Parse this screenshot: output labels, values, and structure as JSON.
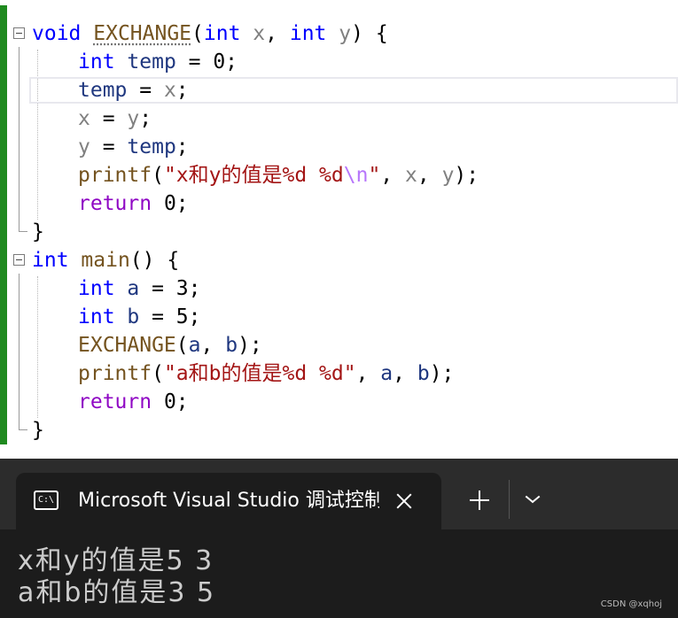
{
  "editor": {
    "lines": [
      {
        "tokens": [
          {
            "t": "void",
            "c": "kw"
          },
          {
            "t": " "
          },
          {
            "t": "EXCHANGE",
            "c": "fn dots"
          },
          {
            "t": "("
          },
          {
            "t": "int",
            "c": "kw"
          },
          {
            "t": " "
          },
          {
            "t": "x",
            "c": "prm"
          },
          {
            "t": ", "
          },
          {
            "t": "int",
            "c": "kw"
          },
          {
            "t": " "
          },
          {
            "t": "y",
            "c": "prm"
          },
          {
            "t": ") {"
          }
        ]
      },
      {
        "tokens": [
          {
            "t": "int",
            "c": "kw"
          },
          {
            "t": " "
          },
          {
            "t": "temp",
            "c": "var"
          },
          {
            "t": " = 0;"
          }
        ]
      },
      {
        "tokens": [
          {
            "t": "temp",
            "c": "var"
          },
          {
            "t": " = "
          },
          {
            "t": "x",
            "c": "prm"
          },
          {
            "t": ";"
          }
        ]
      },
      {
        "tokens": [
          {
            "t": "x",
            "c": "prm"
          },
          {
            "t": " = "
          },
          {
            "t": "y",
            "c": "prm"
          },
          {
            "t": ";"
          }
        ]
      },
      {
        "tokens": [
          {
            "t": "y",
            "c": "prm"
          },
          {
            "t": " = "
          },
          {
            "t": "temp",
            "c": "var"
          },
          {
            "t": ";"
          }
        ]
      },
      {
        "tokens": [
          {
            "t": "printf",
            "c": "fn"
          },
          {
            "t": "("
          },
          {
            "t": "\"x和y的值是%d %d",
            "c": "str"
          },
          {
            "t": "\\n",
            "c": "esc"
          },
          {
            "t": "\"",
            "c": "str"
          },
          {
            "t": ", "
          },
          {
            "t": "x",
            "c": "prm"
          },
          {
            "t": ", "
          },
          {
            "t": "y",
            "c": "prm"
          },
          {
            "t": ");"
          }
        ]
      },
      {
        "tokens": [
          {
            "t": "return",
            "c": "ctl"
          },
          {
            "t": " 0;"
          }
        ]
      },
      {
        "tokens": [
          {
            "t": "}"
          }
        ]
      },
      {
        "tokens": [
          {
            "t": "int",
            "c": "kw"
          },
          {
            "t": " "
          },
          {
            "t": "main",
            "c": "fn"
          },
          {
            "t": "() {"
          }
        ]
      },
      {
        "tokens": [
          {
            "t": "int",
            "c": "kw"
          },
          {
            "t": " "
          },
          {
            "t": "a",
            "c": "var"
          },
          {
            "t": " = 3;"
          }
        ]
      },
      {
        "tokens": [
          {
            "t": "int",
            "c": "kw"
          },
          {
            "t": " "
          },
          {
            "t": "b",
            "c": "var"
          },
          {
            "t": " = 5;"
          }
        ]
      },
      {
        "tokens": [
          {
            "t": "EXCHANGE",
            "c": "fn"
          },
          {
            "t": "("
          },
          {
            "t": "a",
            "c": "var"
          },
          {
            "t": ", "
          },
          {
            "t": "b",
            "c": "var"
          },
          {
            "t": ");"
          }
        ]
      },
      {
        "tokens": [
          {
            "t": "printf",
            "c": "fn"
          },
          {
            "t": "("
          },
          {
            "t": "\"a和b的值是%d %d\"",
            "c": "str"
          },
          {
            "t": ", "
          },
          {
            "t": "a",
            "c": "var"
          },
          {
            "t": ", "
          },
          {
            "t": "b",
            "c": "var"
          },
          {
            "t": ");"
          }
        ]
      },
      {
        "tokens": [
          {
            "t": "return",
            "c": "ctl"
          },
          {
            "t": " 0;"
          }
        ]
      },
      {
        "tokens": [
          {
            "t": "}"
          }
        ]
      }
    ]
  },
  "terminal": {
    "tab_icon": "C:\\",
    "tab_title": "Microsoft Visual Studio 调试控制台",
    "output_lines": [
      "x和y的值是5 3",
      "a和b的值是3 5"
    ]
  },
  "watermark": "CSDN @xqhoj",
  "colors": {
    "keyword": "#0000ff",
    "control": "#8f08c4",
    "function": "#74531f",
    "local": "#1f377f",
    "param": "#808080",
    "string": "#a31515",
    "escape": "#b776fb",
    "change_bar": "#1f8a1f",
    "terminal_bg": "#1c1c1c",
    "tabbar_bg": "#2c2c2c"
  },
  "icons": {
    "fold": "collapse-minus",
    "tab": "console-icon",
    "close": "close-icon",
    "new_tab": "plus-icon",
    "dropdown": "chevron-down-icon"
  }
}
